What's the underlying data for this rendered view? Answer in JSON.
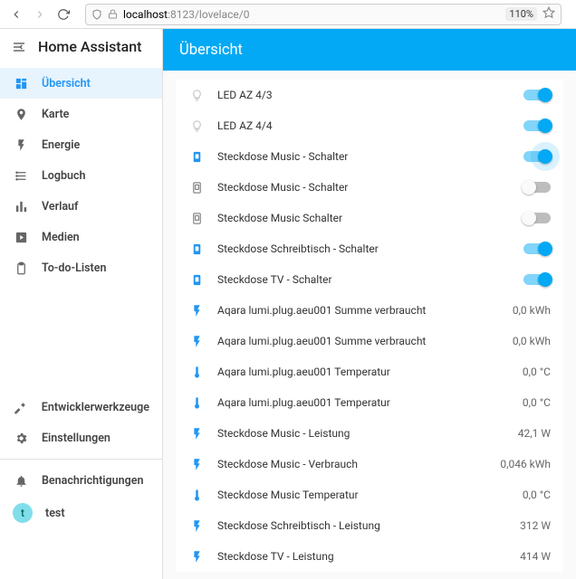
{
  "browser": {
    "url_host": "localhost",
    "url_port_path": ":8123/lovelace/0",
    "zoom": "110%"
  },
  "app_title": "Home Assistant",
  "sidebar": {
    "items": [
      {
        "icon": "dashboard",
        "label": "Übersicht",
        "active": true
      },
      {
        "icon": "map",
        "label": "Karte"
      },
      {
        "icon": "flash",
        "label": "Energie"
      },
      {
        "icon": "logbook",
        "label": "Logbuch"
      },
      {
        "icon": "chart",
        "label": "Verlauf"
      },
      {
        "icon": "play",
        "label": "Medien"
      },
      {
        "icon": "clipboard",
        "label": "To-do-Listen"
      }
    ],
    "bottom": [
      {
        "icon": "hammer",
        "label": "Entwicklerwerkzeuge"
      },
      {
        "icon": "gear",
        "label": "Einstellungen"
      }
    ],
    "footer": [
      {
        "icon": "bell",
        "label": "Benachrichtigungen"
      },
      {
        "icon": "avatar",
        "label": "test",
        "avatar_letter": "t"
      }
    ]
  },
  "page_title": "Übersicht",
  "entities": [
    {
      "icon": "bulb-off",
      "label": "LED AZ 4/3",
      "type": "toggle",
      "state": "on"
    },
    {
      "icon": "bulb-off",
      "label": "LED AZ 4/4",
      "type": "toggle",
      "state": "on"
    },
    {
      "icon": "plug-on",
      "label": "Steckdose Music - Schalter",
      "type": "toggle",
      "state": "on",
      "glow": true
    },
    {
      "icon": "plug-off",
      "label": "Steckdose Music - Schalter",
      "type": "toggle",
      "state": "off"
    },
    {
      "icon": "plug-off",
      "label": "Steckdose Music Schalter",
      "type": "toggle",
      "state": "off"
    },
    {
      "icon": "plug-on",
      "label": "Steckdose Schreibtisch - Schalter",
      "type": "toggle",
      "state": "on"
    },
    {
      "icon": "plug-on",
      "label": "Steckdose TV - Schalter",
      "type": "toggle",
      "state": "on"
    },
    {
      "icon": "flash",
      "label": "Aqara lumi.plug.aeu001 Summe verbraucht",
      "type": "sensor",
      "value": "0,0 kWh"
    },
    {
      "icon": "flash",
      "label": "Aqara lumi.plug.aeu001 Summe verbraucht",
      "type": "sensor",
      "value": "0,0 kWh"
    },
    {
      "icon": "thermo",
      "label": "Aqara lumi.plug.aeu001 Temperatur",
      "type": "sensor",
      "value": "0,0 °C"
    },
    {
      "icon": "thermo",
      "label": "Aqara lumi.plug.aeu001 Temperatur",
      "type": "sensor",
      "value": "0,0 °C"
    },
    {
      "icon": "flash",
      "label": "Steckdose Music - Leistung",
      "type": "sensor",
      "value": "42,1 W"
    },
    {
      "icon": "flash",
      "label": "Steckdose Music - Verbrauch",
      "type": "sensor",
      "value": "0,046 kWh"
    },
    {
      "icon": "thermo",
      "label": "Steckdose Music Temperatur",
      "type": "sensor",
      "value": "0,0 °C"
    },
    {
      "icon": "flash",
      "label": "Steckdose Schreibtisch - Leistung",
      "type": "sensor",
      "value": "312 W"
    },
    {
      "icon": "flash",
      "label": "Steckdose TV - Leistung",
      "type": "sensor",
      "value": "414 W"
    }
  ]
}
